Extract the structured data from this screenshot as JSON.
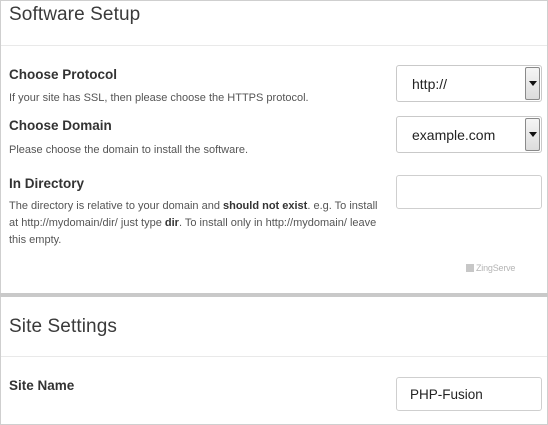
{
  "software_setup": {
    "title": "Software Setup",
    "protocol": {
      "label": "Choose Protocol",
      "help": "If your site has SSL, then please choose the HTTPS protocol.",
      "value": "http://"
    },
    "domain": {
      "label": "Choose Domain",
      "help": "Please choose the domain to install the software.",
      "value": "example.com"
    },
    "directory": {
      "label": "In Directory",
      "help_part1": "The directory is relative to your domain and ",
      "help_bold1": "should not exist",
      "help_part2": ". e.g. To install at http://mydomain/dir/ just type ",
      "help_bold2": "dir",
      "help_part3": ". To install only in http://mydomain/ leave this empty.",
      "value": ""
    },
    "watermark": "ZingServe"
  },
  "site_settings": {
    "title": "Site Settings",
    "site_name": {
      "label": "Site Name",
      "value": "PHP-Fusion"
    }
  }
}
